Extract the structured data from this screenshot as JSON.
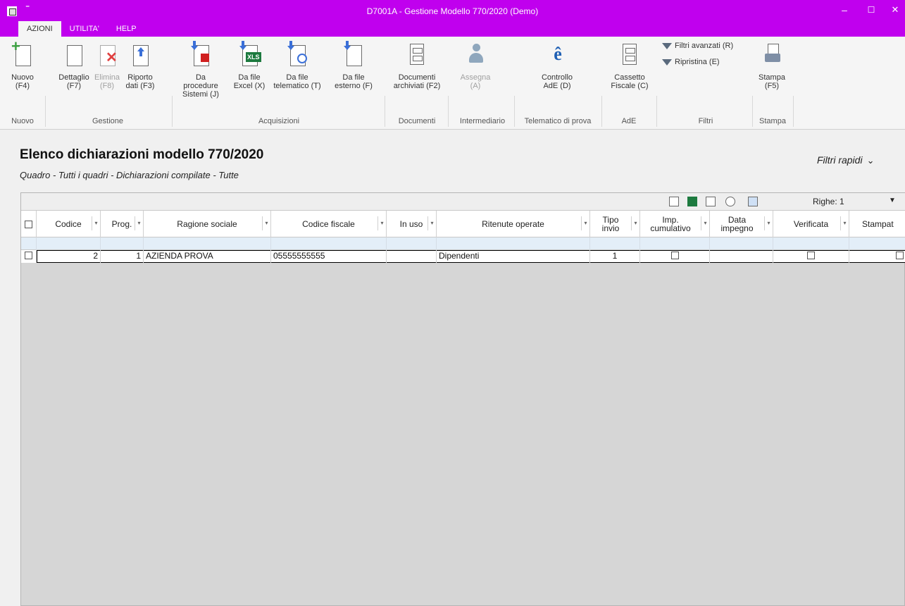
{
  "window": {
    "title": "D7001A - Gestione Modello 770/2020  (Demo)",
    "minimize": "–",
    "maximize": "☐",
    "close": "✕",
    "quick_access": "⚲"
  },
  "tabs": [
    {
      "label": "AZIONI"
    },
    {
      "label": "UTILITA'"
    },
    {
      "label": "HELP"
    }
  ],
  "ribbon": {
    "nuovo": {
      "line1": "Nuovo",
      "line2": "(F4)"
    },
    "dettaglio": {
      "line1": "Dettaglio",
      "line2": "(F7)"
    },
    "elimina": {
      "line1": "Elimina",
      "line2": "(F8)"
    },
    "riporto": {
      "line1": "Riporto",
      "line2": "dati (F3)"
    },
    "da_procedure": {
      "line1": "Da procedure",
      "line2": "Sistemi (J)"
    },
    "da_excel": {
      "line1": "Da file",
      "line2": "Excel (X)",
      "badge": "XLS"
    },
    "da_telematico": {
      "line1": "Da file",
      "line2": "telematico (T)"
    },
    "da_esterno": {
      "line1": "Da file",
      "line2": "esterno (F)"
    },
    "documenti": {
      "line1": "Documenti",
      "line2": "archiviati (F2)"
    },
    "assegna": {
      "line1": "Assegna",
      "line2": "(A)"
    },
    "controllo": {
      "line1": "Controllo",
      "line2": "AdE (D)"
    },
    "cassetto": {
      "line1": "Cassetto",
      "line2": "Fiscale (C)"
    },
    "filtri_avanzati": "Filtri avanzati (R)",
    "ripristina": "Ripristina (E)",
    "stampa": {
      "line1": "Stampa",
      "line2": "(F5)"
    },
    "groups": {
      "nuovo": "Nuovo",
      "gestione": "Gestione",
      "acquisizioni": "Acquisizioni",
      "documenti": "Documenti",
      "intermediario": "Intermediario",
      "telematico": "Telematico di prova",
      "ade": "AdE",
      "filtri": "Filtri",
      "stampa": "Stampa"
    }
  },
  "page": {
    "title": "Elenco dichiarazioni modello 770/2020",
    "subtitle": "Quadro - Tutti i quadri - Dichiarazioni compilate - Tutte",
    "filtri_rapidi": "Filtri rapidi",
    "filtri_rapidi_chevron": "⌄"
  },
  "grid": {
    "righe_label": "Righe: 1",
    "dropdown": "▼",
    "columns": [
      {
        "line1": "Codice",
        "line2": ""
      },
      {
        "line1": "Prog.",
        "line2": ""
      },
      {
        "line1": "Ragione sociale",
        "line2": ""
      },
      {
        "line1": "Codice fiscale",
        "line2": ""
      },
      {
        "line1": "In uso",
        "line2": ""
      },
      {
        "line1": "Ritenute operate",
        "line2": ""
      },
      {
        "line1": "Tipo",
        "line2": "invio"
      },
      {
        "line1": "Imp.",
        "line2": "cumulativo"
      },
      {
        "line1": "Data",
        "line2": "impegno"
      },
      {
        "line1": "Verificata",
        "line2": ""
      },
      {
        "line1": "Stampat",
        "line2": ""
      }
    ],
    "filter_arrow": "▾",
    "rows": [
      {
        "codice": "2",
        "prog": "1",
        "ragione_sociale": "AZIENDA PROVA",
        "codice_fiscale": "05555555555",
        "in_uso": "",
        "ritenute": "Dipendenti",
        "tipo_invio": "1",
        "imp_cumulativo": false,
        "data_impegno": "",
        "verificata": false,
        "stampata": false
      }
    ]
  },
  "colors": {
    "titlebar": "#c000ee",
    "ribbon_bg": "#f5f5f5",
    "grid_empty": "#d6d6d6",
    "filter_row": "#e3eef8"
  }
}
